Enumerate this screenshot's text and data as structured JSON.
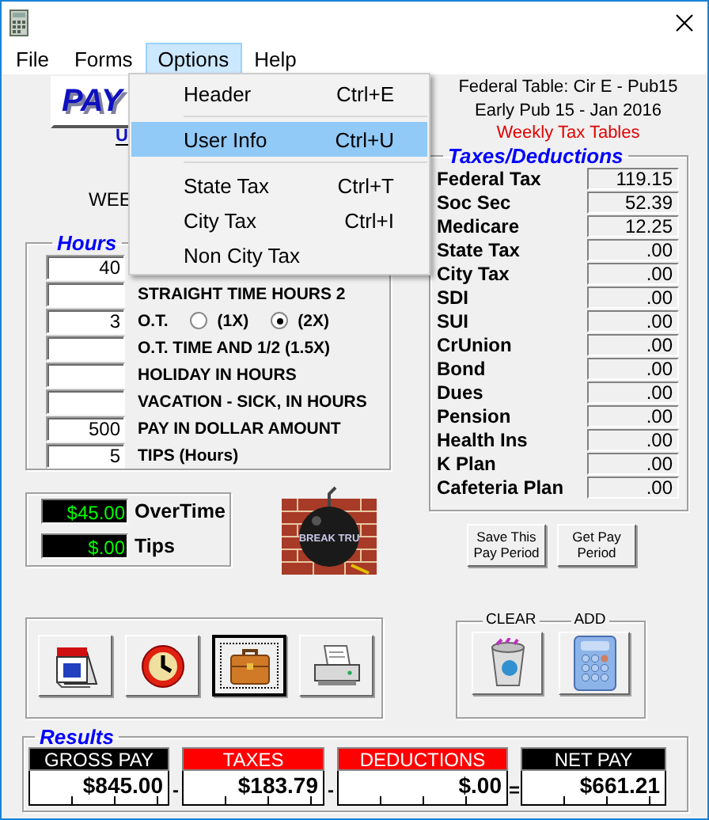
{
  "menu_bar": [
    {
      "label": "File",
      "selected": false
    },
    {
      "label": "Forms",
      "selected": false
    },
    {
      "label": "Options",
      "selected": true
    },
    {
      "label": "Help",
      "selected": false
    }
  ],
  "dropdown": {
    "items": [
      {
        "kind": "item",
        "label": "Header",
        "shortcut": "Ctrl+E",
        "selected": false
      },
      {
        "kind": "separator"
      },
      {
        "kind": "item",
        "label": "User Info",
        "shortcut": "Ctrl+U",
        "selected": true
      },
      {
        "kind": "separator"
      },
      {
        "kind": "item",
        "label": "State Tax",
        "shortcut": "Ctrl+T",
        "selected": false
      },
      {
        "kind": "item",
        "label": "City Tax",
        "shortcut": "Ctrl+I",
        "selected": false
      },
      {
        "kind": "item",
        "label": "Non City Tax",
        "selected": false
      }
    ]
  },
  "logo": {
    "text": "PAY",
    "subtext": "U"
  },
  "period_label": "WEE",
  "table_info": {
    "federal": "Federal Table: Cir E - Pub15",
    "pub": "Early Pub 15 - Jan 2016",
    "tables": "Weekly Tax Tables"
  },
  "hours": {
    "title": "Hours",
    "rows": [
      {
        "kind": "field",
        "value": "40"
      },
      {
        "kind": "field",
        "label": "STRAIGHT TIME HOURS 2"
      },
      {
        "kind": "overtime",
        "value": "3",
        "label": "O.T.",
        "options": [
          {
            "label": "(1X)",
            "selected": false
          },
          {
            "label": "(2X)",
            "selected": true
          }
        ]
      },
      {
        "kind": "field",
        "label": "O.T. TIME AND 1/2 (1.5X)"
      },
      {
        "kind": "field",
        "label": "HOLIDAY IN HOURS"
      },
      {
        "kind": "field",
        "label": "VACATION - SICK, IN HOURS"
      },
      {
        "kind": "field",
        "value": "500",
        "label": "PAY IN DOLLAR AMOUNT"
      },
      {
        "kind": "field",
        "value": "5",
        "label": "TIPS (Hours)"
      }
    ]
  },
  "taxes": {
    "title": "Taxes/Deductions",
    "rows": [
      {
        "label": "Federal Tax",
        "value": "119.15"
      },
      {
        "label": "Soc Sec",
        "value": "52.39"
      },
      {
        "label": "Medicare",
        "value": "12.25"
      },
      {
        "label": "State Tax",
        "value": ".00"
      },
      {
        "label": "City Tax",
        "value": ".00"
      },
      {
        "label": "SDI",
        "value": ".00"
      },
      {
        "label": "SUI",
        "value": ".00"
      },
      {
        "label": "CrUnion",
        "value": ".00"
      },
      {
        "label": "Bond",
        "value": ".00"
      },
      {
        "label": "Dues",
        "value": ".00"
      },
      {
        "label": "Pension",
        "value": ".00"
      },
      {
        "label": "Health Ins",
        "value": ".00"
      },
      {
        "label": "K Plan",
        "value": ".00"
      },
      {
        "label": "Cafeteria Plan",
        "value": ".00"
      }
    ]
  },
  "totals": [
    {
      "label": "OverTime",
      "value": "$45.00"
    },
    {
      "label": "Tips",
      "value": "$.00"
    }
  ],
  "badge_logo": {
    "text": "BREAK TRU"
  },
  "period_buttons": [
    "Save This Pay Period",
    "Get Pay Period"
  ],
  "tools": [
    {
      "kind": "calendar",
      "focused": false
    },
    {
      "kind": "clock",
      "focused": false
    },
    {
      "kind": "briefcase",
      "focused": true
    },
    {
      "kind": "printer",
      "focused": false
    }
  ],
  "calc": {
    "clear": "CLEAR",
    "add": "ADD"
  },
  "results": {
    "title": "Results",
    "items": [
      {
        "label": "GROSS PAY",
        "value": "$845.00",
        "color": "#000000",
        "operator": "-"
      },
      {
        "label": "TAXES",
        "value": "$183.79",
        "color": "#ff0000",
        "operator": "-"
      },
      {
        "label": "DEDUCTIONS",
        "value": "$.00",
        "color": "#ff0000",
        "operator": "="
      },
      {
        "label": "NET PAY",
        "value": "$661.21",
        "color": "#000000"
      }
    ]
  }
}
